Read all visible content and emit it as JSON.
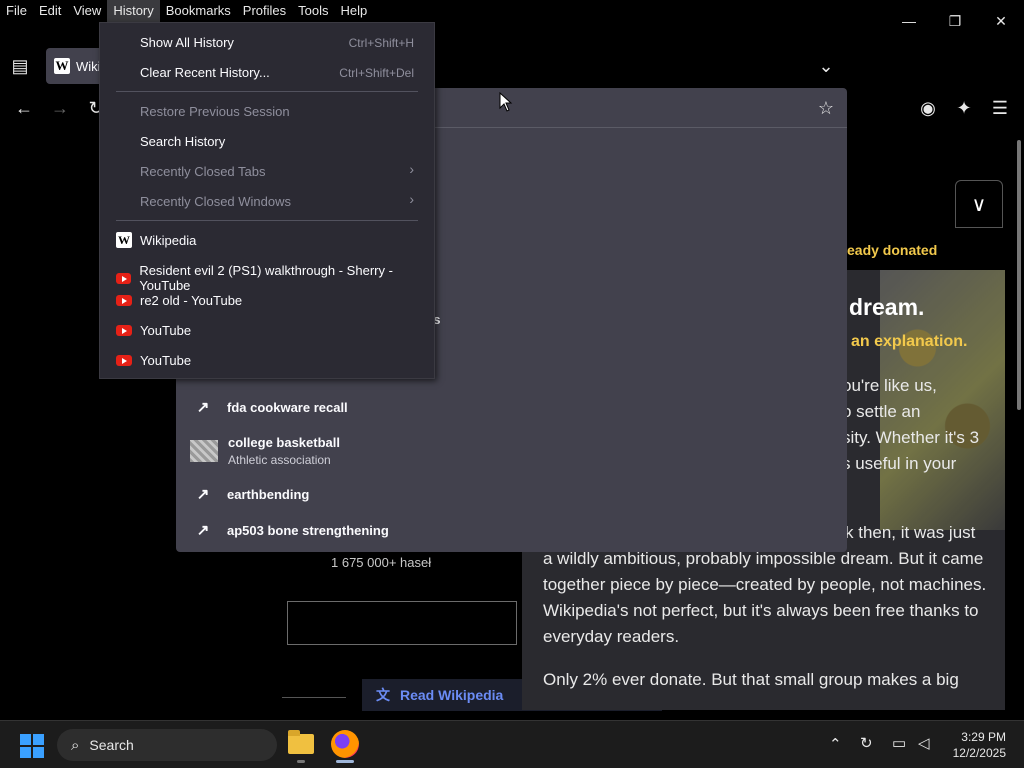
{
  "menubar": {
    "items": [
      "File",
      "Edit",
      "View",
      "History",
      "Bookmarks",
      "Profiles",
      "Tools",
      "Help"
    ],
    "active": "History"
  },
  "tab": {
    "label": "Wiki"
  },
  "history_menu": {
    "show_all": "Show All History",
    "show_all_shortcut": "Ctrl+Shift+H",
    "clear_recent": "Clear Recent History...",
    "clear_recent_shortcut": "Ctrl+Shift+Del",
    "restore_session": "Restore Previous Session",
    "search_history": "Search History",
    "recently_closed_tabs": "Recently Closed Tabs",
    "recently_closed_windows": "Recently Closed Windows",
    "entries": [
      {
        "label": "Wikipedia",
        "icon": "wikipedia-icon"
      },
      {
        "label": "Resident evil 2 (PS1) walkthrough - Sherry - YouTube",
        "icon": "youtube-icon"
      },
      {
        "label": "re2 old - YouTube",
        "icon": "youtube-icon"
      },
      {
        "label": "YouTube",
        "icon": "youtube-icon"
      },
      {
        "label": "YouTube",
        "icon": "youtube-icon"
      }
    ]
  },
  "suggestions": {
    "partial_text": "ras",
    "items": [
      {
        "title": "fda cookware recall",
        "subtitle": "",
        "icon": "trending-icon"
      },
      {
        "title": "college basketball",
        "subtitle": "Athletic association",
        "icon": "thumbnail"
      },
      {
        "title": "earthbending",
        "subtitle": "",
        "icon": "trending-icon"
      },
      {
        "title": "ap503 bone strengthening",
        "subtitle": "",
        "icon": "trending-icon"
      }
    ]
  },
  "wikipedia": {
    "article_count": "1 675 000+ haseł",
    "read_button": "Read Wikipedia"
  },
  "banner": {
    "already_donated": "eady donated",
    "headline": "dream.",
    "explanation": "an explanation.",
    "lines_right": [
      "ou're like us,",
      "o settle an",
      "sity. Whether it's 3",
      "s useful in your"
    ],
    "paragraph_1": [
      "k then, it was just",
      "a wildly ambitious, probably impossible dream. But it came",
      "together piece by piece—created by people, not machines.",
      "Wikipedia's not perfect, but it's always been free thanks to",
      "everyday readers."
    ],
    "paragraph_2": "Only 2% ever donate. But that small group makes a big"
  },
  "taskbar": {
    "search_placeholder": "Search",
    "time": "3:29 PM",
    "date": "12/2/2025"
  }
}
